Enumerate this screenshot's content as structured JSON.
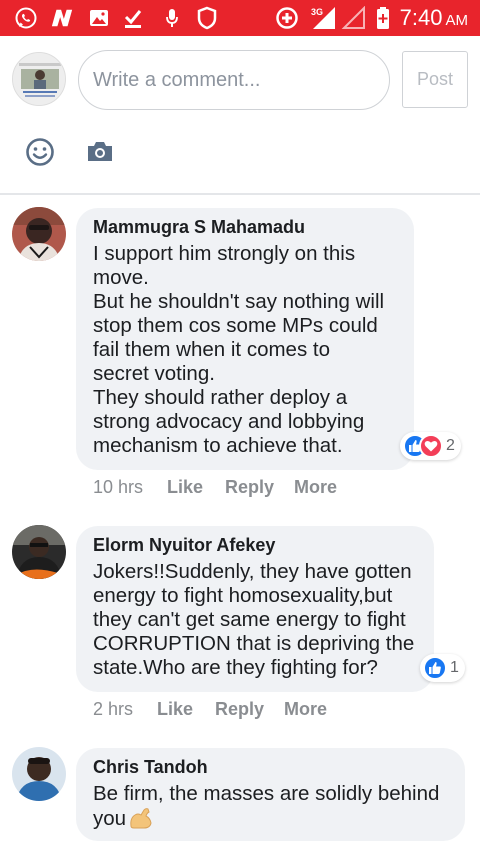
{
  "status_bar": {
    "time": "7:40",
    "ampm": "AM",
    "network": "3G"
  },
  "composer": {
    "placeholder": "Write a comment...",
    "post_label": "Post"
  },
  "comments": [
    {
      "author": "Mammugra S Mahamadu",
      "lines": [
        "I support him strongly on this",
        "move.",
        "But he shouldn't say nothing will",
        "stop them cos some MPs could",
        "fail them when it comes to",
        "secret voting.",
        "They should rather deploy a",
        "strong advocacy and lobbying",
        "mechanism to achieve that."
      ],
      "reaction_count": "2",
      "time": "10 hrs",
      "like": "Like",
      "reply": "Reply",
      "more": "More"
    },
    {
      "author": "Elorm Nyuitor Afekey",
      "lines": [
        "Jokers!!Suddenly, they have gotten",
        "energy to fight homosexuality,but",
        "they can't get same energy to fight",
        "CORRUPTION that is depriving the",
        "state.Who are they fighting for?"
      ],
      "reaction_count": "1",
      "time": "2 hrs",
      "like": "Like",
      "reply": "Reply",
      "more": "More"
    },
    {
      "author": "Chris Tandoh",
      "lines": [
        "Be firm, the masses are solidly behind",
        "you"
      ]
    }
  ],
  "colors": {
    "status_bar": "#e8242c",
    "bubble": "#f0f2f5",
    "like_blue": "#1877f2",
    "love_red": "#f33e58",
    "meta_gray": "#8a8d91"
  },
  "icons": [
    "whatsapp-icon",
    "n-app-icon",
    "gallery-icon",
    "download-check-icon",
    "microphone-icon",
    "shield-icon",
    "data-saver-icon",
    "signal-icon",
    "battery-icon",
    "emoji-icon",
    "camera-icon",
    "like-reaction-icon",
    "love-reaction-icon",
    "flexed-biceps-emoji"
  ]
}
